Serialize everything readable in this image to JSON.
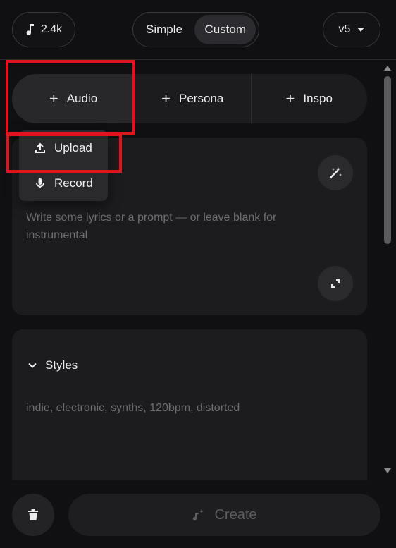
{
  "header": {
    "credits": "2.4k",
    "mode_simple": "Simple",
    "mode_custom": "Custom",
    "version": "v5"
  },
  "sources": {
    "audio": "Audio",
    "persona": "Persona",
    "inspo": "Inspo"
  },
  "audio_menu": {
    "upload": "Upload",
    "record": "Record"
  },
  "lyrics": {
    "placeholder": "Write some lyrics or a prompt — or leave blank for instrumental"
  },
  "styles": {
    "label": "Styles",
    "placeholder": "indie, electronic, synths, 120bpm, distorted"
  },
  "footer": {
    "create": "Create"
  },
  "colors": {
    "background": "#101012",
    "card": "#1c1c1f",
    "highlight": "#e0141a",
    "muted_text": "#6d6d72"
  }
}
